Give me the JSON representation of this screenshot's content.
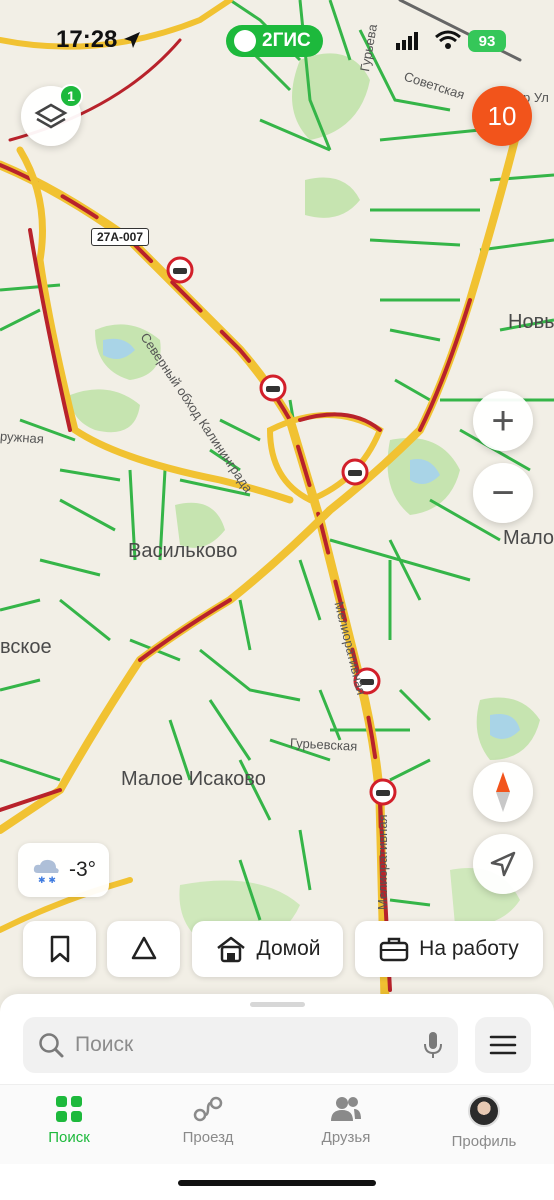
{
  "status_bar": {
    "time": "17:28",
    "brand": "2ГИС",
    "battery": "93"
  },
  "map": {
    "layers_badge": "1",
    "traffic_score": "10",
    "road_sign": "27А-007",
    "places": {
      "vasilkovo": "Васильково",
      "maloe_isakovo": "Малое Исаково",
      "novy": "Новы",
      "maloe": "Малое",
      "vskoe": "вское",
      "ruzhnaya": "ружная"
    },
    "streets": {
      "severny": "Северный обход Калининграда",
      "meliorativnaya_1": "Мелиоративная",
      "meliorativnaya_2": "Мелиоративная",
      "guryevskaya": "Гурьевская",
      "sovetskaya": "Советская",
      "guryeva": "Гурьева",
      "ulitsa": "пр Ул"
    },
    "controls": {
      "zoom_in": "+",
      "zoom_out": "−"
    }
  },
  "weather": {
    "temperature": "-3°",
    "icon": "snow-cloud-icon"
  },
  "quick_actions": {
    "bookmark": "bookmark-icon",
    "bell": "bell-icon",
    "home": "Домой",
    "work": "На работу"
  },
  "search": {
    "placeholder": "Поиск"
  },
  "tabs": [
    {
      "label": "Поиск",
      "icon": "grid-icon",
      "active": true
    },
    {
      "label": "Проезд",
      "icon": "route-icon",
      "active": false
    },
    {
      "label": "Друзья",
      "icon": "friends-icon",
      "active": false
    },
    {
      "label": "Профиль",
      "icon": "avatar",
      "active": false
    }
  ],
  "colors": {
    "brand_green": "#1db93c",
    "traffic_orange": "#f2541b",
    "road_yellow": "#f1c232",
    "road_red": "#b8222b",
    "road_green": "#35b548"
  }
}
